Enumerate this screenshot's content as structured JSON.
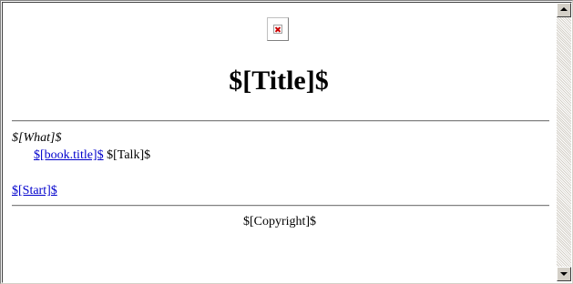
{
  "page": {
    "logo_icon": "broken-image-icon",
    "title": "$[Title]$",
    "what": "$[What]$",
    "entry": {
      "book_link": "$[book.title]$",
      "talk": "$[Talk]$"
    },
    "start_link": "$[Start]$",
    "copyright": "$[Copyright]$"
  },
  "colors": {
    "link": "#0000cc",
    "broken_image_x": "#cc0000",
    "rule": "#808080",
    "scrollbar": "#d4d0c8"
  },
  "scrollbar": {
    "up_icon": "scroll-up-arrow-icon",
    "down_icon": "scroll-down-arrow-icon"
  }
}
